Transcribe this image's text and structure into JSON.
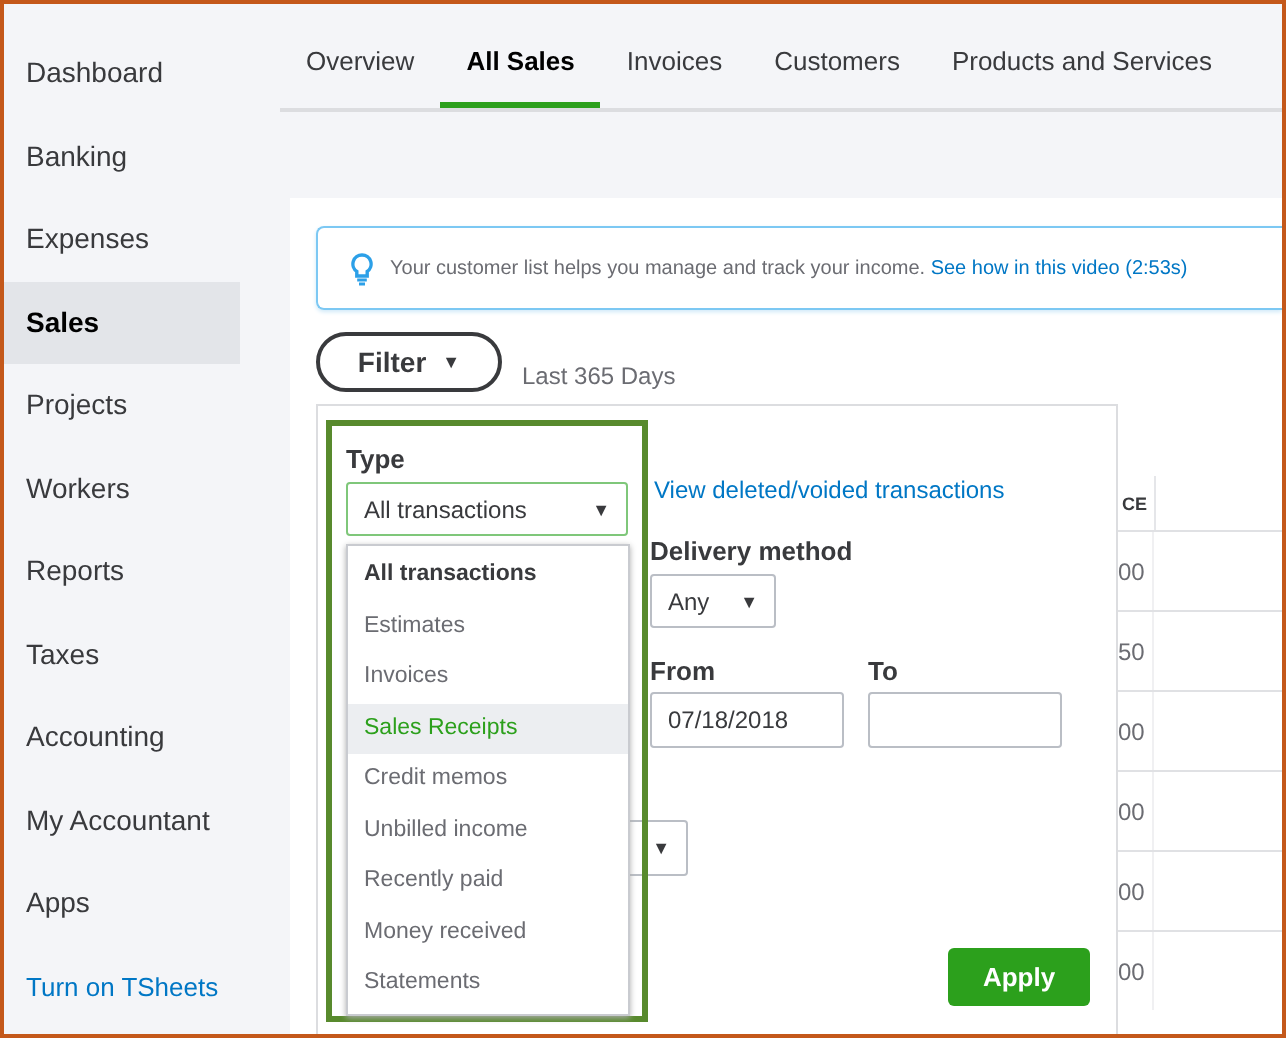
{
  "sidebar": {
    "items": [
      {
        "label": "Dashboard",
        "kind": "item",
        "selected": false
      },
      {
        "label": "Banking",
        "kind": "item",
        "selected": false
      },
      {
        "label": "Expenses",
        "kind": "item",
        "selected": false
      },
      {
        "label": "Sales",
        "kind": "item",
        "selected": true
      },
      {
        "label": "Projects",
        "kind": "item",
        "selected": false
      },
      {
        "label": "Workers",
        "kind": "item",
        "selected": false
      },
      {
        "label": "Reports",
        "kind": "item",
        "selected": false
      },
      {
        "label": "Taxes",
        "kind": "item",
        "selected": false
      },
      {
        "label": "Accounting",
        "kind": "item",
        "selected": false
      },
      {
        "label": "My Accountant",
        "kind": "item",
        "selected": false
      },
      {
        "label": "Apps",
        "kind": "item",
        "selected": false
      },
      {
        "label": "Turn on TSheets",
        "kind": "link",
        "selected": false
      }
    ]
  },
  "tabs": [
    {
      "label": "Overview",
      "selected": false
    },
    {
      "label": "All Sales",
      "selected": true
    },
    {
      "label": "Invoices",
      "selected": false
    },
    {
      "label": "Customers",
      "selected": false
    },
    {
      "label": "Products and Services",
      "selected": false
    }
  ],
  "banner": {
    "text": "Your customer list helps you manage and track your income.",
    "link": "See how in this video (2:53s)"
  },
  "filter": {
    "button": "Filter",
    "caret": "▼",
    "range": "Last 365 Days"
  },
  "filter_panel": {
    "type_label": "Type",
    "type_value": "All transactions",
    "type_caret": "▼",
    "type_options": [
      {
        "label": "All transactions",
        "selected": true,
        "highlighted": false
      },
      {
        "label": "Estimates",
        "selected": false,
        "highlighted": false
      },
      {
        "label": "Invoices",
        "selected": false,
        "highlighted": false
      },
      {
        "label": "Sales Receipts",
        "selected": false,
        "highlighted": true
      },
      {
        "label": "Credit memos",
        "selected": false,
        "highlighted": false
      },
      {
        "label": "Unbilled income",
        "selected": false,
        "highlighted": false
      },
      {
        "label": "Recently paid",
        "selected": false,
        "highlighted": false
      },
      {
        "label": "Money received",
        "selected": false,
        "highlighted": false
      },
      {
        "label": "Statements",
        "selected": false,
        "highlighted": false
      }
    ],
    "deleted_link": "View deleted/voided transactions",
    "delivery_label": "Delivery method",
    "delivery_value": "Any",
    "delivery_caret": "▼",
    "from_label": "From",
    "from_value": "07/18/2018",
    "to_label": "To",
    "hidden_caret": "▼",
    "apply": "Apply"
  },
  "table": {
    "column_1": "CE",
    "rows": [
      [
        "00"
      ],
      [
        "50"
      ],
      [
        "00"
      ],
      [
        "00"
      ],
      [
        "00"
      ],
      [
        "00"
      ]
    ]
  }
}
